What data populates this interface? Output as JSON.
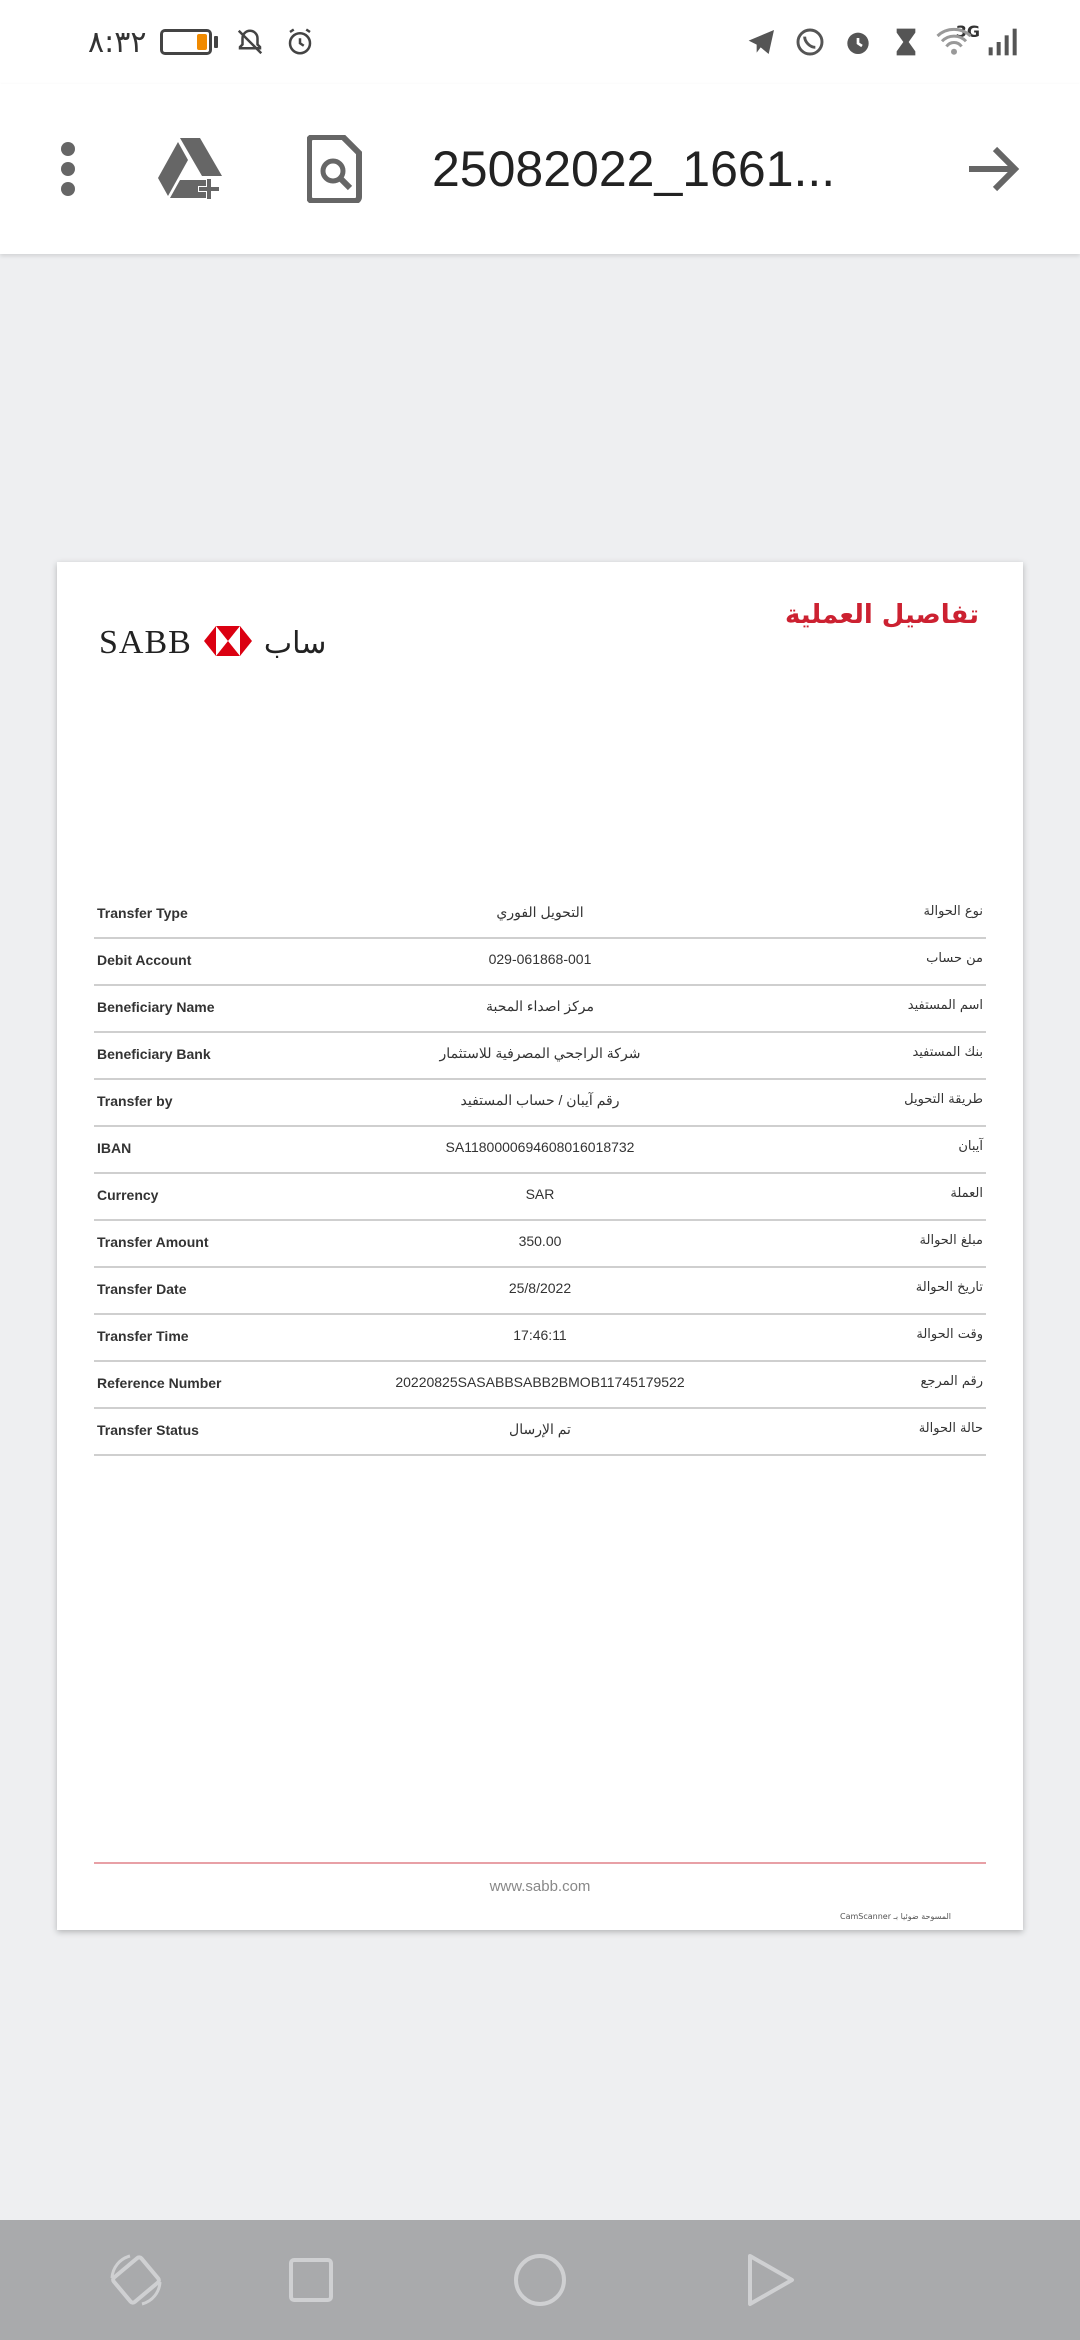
{
  "status_bar": {
    "time": "٨:٣٢",
    "network": "3G",
    "icons": [
      "battery-icon",
      "notifications-off-icon",
      "alarm-icon",
      "telegram-icon",
      "whatsapp-icon",
      "alarm-icon",
      "hourglass-icon",
      "wifi-icon",
      "signal-icon"
    ]
  },
  "toolbar": {
    "title": "25082022_1661...",
    "icons": [
      "more-vert-icon",
      "drive-add-icon",
      "find-in-page-icon",
      "forward-arrow-icon"
    ]
  },
  "document": {
    "heading": "تفاصيل العملية",
    "logo_latin": "SABB",
    "logo_arabic": "ساب",
    "rows": [
      {
        "en": "Transfer Type",
        "value": "التحويل الفوري",
        "ar": "نوع الحوالة"
      },
      {
        "en": "Debit Account",
        "value": "029-061868-001",
        "ar": "من حساب"
      },
      {
        "en": "Beneficiary Name",
        "value": "مركز اصداء المحبة",
        "ar": "اسم المستفيد"
      },
      {
        "en": "Beneficiary Bank",
        "value": "شركة الراجحي المصرفية للاستثمار",
        "ar": "بنك المستفيد"
      },
      {
        "en": "Transfer by",
        "value": "رقم آيبان / حساب المستفيد",
        "ar": "طريقة التحويل"
      },
      {
        "en": "IBAN",
        "value": "SA1180000694608016018732",
        "ar": "آيبان"
      },
      {
        "en": "Currency",
        "value": "SAR",
        "ar": "العملة"
      },
      {
        "en": "Transfer Amount",
        "value": "350.00",
        "ar": "مبلغ الحوالة"
      },
      {
        "en": "Transfer Date",
        "value": "25/8/2022",
        "ar": "تاريخ الحوالة"
      },
      {
        "en": "Transfer Time",
        "value": "17:46:11",
        "ar": "وقت الحوالة"
      },
      {
        "en": "Reference Number",
        "value": "20220825SASABBSABB2BMOB11745179522",
        "ar": "رقم المرجع"
      },
      {
        "en": "Transfer Status",
        "value": "تم الإرسال",
        "ar": "حالة الحوالة"
      }
    ],
    "footer_url": "www.sabb.com",
    "footer_scanner": "CamScanner المسوحة ضوئيا بـ"
  },
  "nav_bar": {
    "buttons": [
      "rotate-icon",
      "recents-icon",
      "home-icon",
      "back-icon"
    ]
  },
  "colors": {
    "accent_red": "#cc2131",
    "background": "#eeeff1",
    "navbar": "#a9aaac"
  }
}
